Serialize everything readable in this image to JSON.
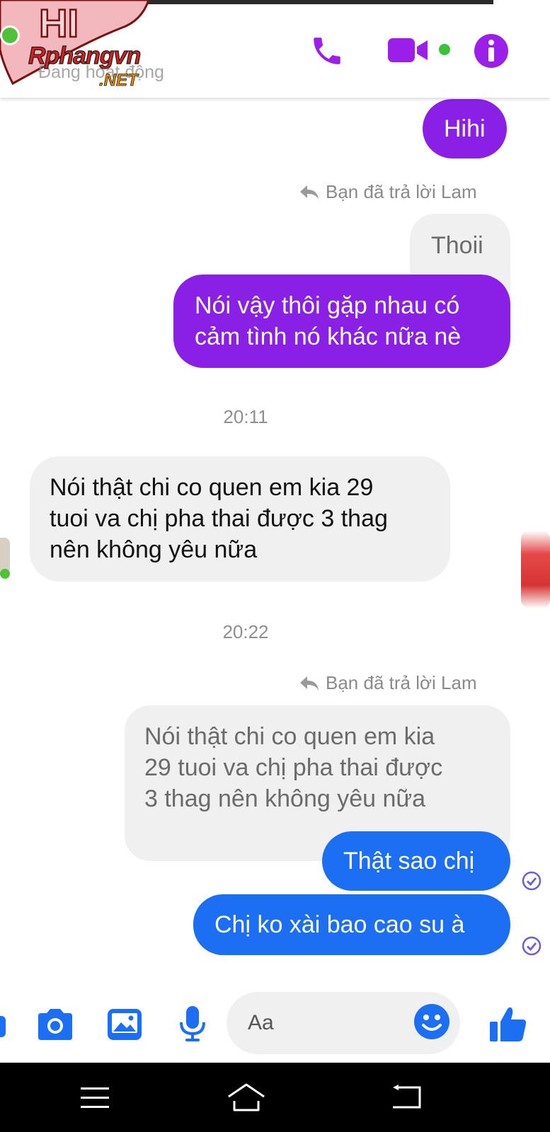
{
  "header": {
    "watermark_top": "HI",
    "watermark_brand": "Rphangvn",
    "watermark_domain": ".NET",
    "status": "Đang hoạt động"
  },
  "messages": {
    "m1": "Hihi",
    "reply_note_1": "Bạn đã trả lời Lam",
    "quoted_1": "Thoii",
    "m2": "Nói vậy thôi gặp nhau có\ncảm tình nó khác nữa nè",
    "time_1": "20:11",
    "m3": "Nói thật chi co quen em kia 29\ntuoi va chị pha thai được 3 thag\nnên không yêu nữa",
    "time_2": "20:22",
    "reply_note_2": "Bạn đã trả lời Lam",
    "quoted_2": "Nói thật chi co quen em kia\n29 tuoi va chị pha thai được\n3 thag nên không yêu nữa",
    "m4": "Thật sao chị",
    "m5": "Chị ko xài bao cao su à"
  },
  "composer": {
    "placeholder": "Aa"
  },
  "colors": {
    "messenger_purple": "#8a1fe6",
    "messenger_blue": "#1c6ff3",
    "incoming_bg": "#f0f0f0",
    "header_icon": "#9b1fe8",
    "composer_icon": "#1c6ff3"
  },
  "icons": {
    "call": "phone-icon",
    "video": "video-camera-icon",
    "info": "info-icon",
    "camera": "camera-icon",
    "gallery": "image-icon",
    "mic": "microphone-icon",
    "emoji": "smiley-icon",
    "like": "thumbs-up-icon",
    "reply": "reply-arrow-icon",
    "seen": "check-circle-icon",
    "nav_menu": "menu-icon",
    "nav_home": "home-icon",
    "nav_back": "back-icon"
  }
}
